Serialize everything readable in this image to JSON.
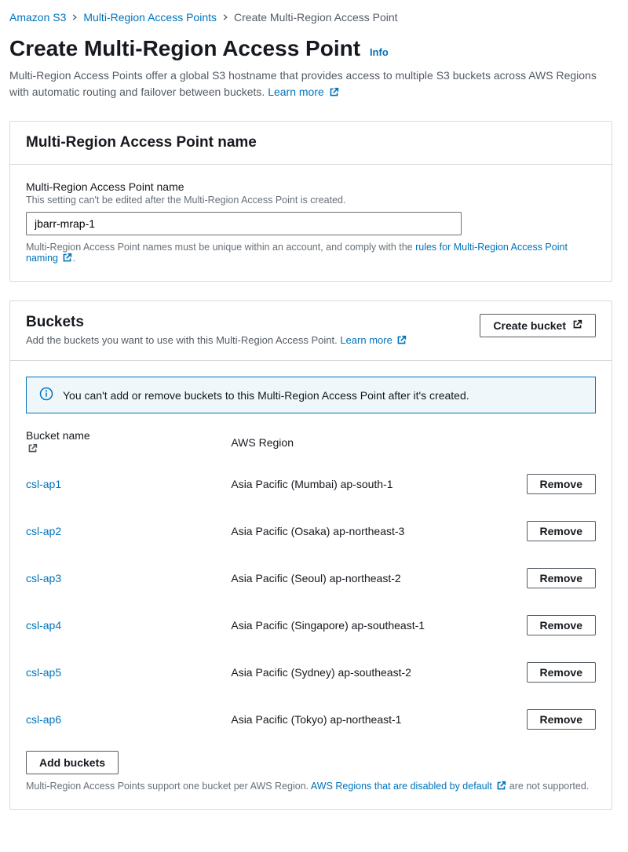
{
  "breadcrumb": {
    "items": [
      "Amazon S3",
      "Multi-Region Access Points",
      "Create Multi-Region Access Point"
    ]
  },
  "header": {
    "title": "Create Multi-Region Access Point",
    "info": "Info",
    "desc_prefix": "Multi-Region Access Points offer a global S3 hostname that provides access to multiple S3 buckets across AWS Regions with automatic routing and failover between buckets. ",
    "learn_more": "Learn more"
  },
  "name_panel": {
    "title": "Multi-Region Access Point name",
    "field_label": "Multi-Region Access Point name",
    "field_hint": "This setting can't be edited after the Multi-Region Access Point is created.",
    "value": "jbarr-mrap-1",
    "help_prefix": "Multi-Region Access Point names must be unique within an account, and comply with the ",
    "rules_link": "rules for Multi-Region Access Point naming",
    "help_suffix": "."
  },
  "buckets_panel": {
    "title": "Buckets",
    "subtitle_prefix": "Add the buckets you want to use with this Multi-Region Access Point. ",
    "learn_more": "Learn more",
    "create_bucket": "Create bucket",
    "alert": "You can't add or remove buckets to this Multi-Region Access Point after it's created.",
    "col_name": "Bucket name",
    "col_region": "AWS Region",
    "remove": "Remove",
    "rows": [
      {
        "name": "csl-ap1",
        "region": "Asia Pacific (Mumbai) ap-south-1"
      },
      {
        "name": "csl-ap2",
        "region": "Asia Pacific (Osaka) ap-northeast-3"
      },
      {
        "name": "csl-ap3",
        "region": "Asia Pacific (Seoul) ap-northeast-2"
      },
      {
        "name": "csl-ap4",
        "region": "Asia Pacific (Singapore) ap-southeast-1"
      },
      {
        "name": "csl-ap5",
        "region": "Asia Pacific (Sydney) ap-southeast-2"
      },
      {
        "name": "csl-ap6",
        "region": "Asia Pacific (Tokyo) ap-northeast-1"
      }
    ],
    "add_buckets": "Add buckets",
    "footer_prefix": "Multi-Region Access Points support one bucket per AWS Region. ",
    "footer_link": "AWS Regions that are disabled by default",
    "footer_suffix": " are not supported."
  }
}
